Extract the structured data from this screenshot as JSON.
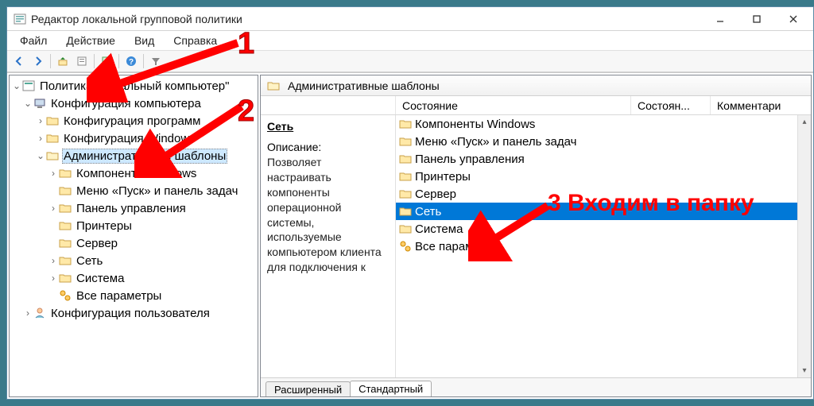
{
  "window": {
    "title": "Редактор локальной групповой политики"
  },
  "menu": {
    "file": "Файл",
    "action": "Действие",
    "view": "Вид",
    "help": "Справка"
  },
  "tree": {
    "root": "Политика \"Локальный компьютер\"",
    "comp_cfg": "Конфигурация компьютера",
    "sw_cfg": "Конфигурация программ",
    "win_cfg": "Конфигурация Windows",
    "admin_tpl": "Административные шаблоны",
    "comp_win": "Компоненты Windows",
    "start_menu": "Меню «Пуск» и панель задач",
    "ctrl_panel": "Панель управления",
    "printers": "Принтеры",
    "server": "Сервер",
    "network": "Сеть",
    "system": "Система",
    "all_params": "Все параметры",
    "user_cfg": "Конфигурация пользователя"
  },
  "detail": {
    "header": "Административные шаблоны",
    "section_title": "Сеть",
    "desc_label": "Описание:",
    "desc_text": "Позволяет настраивать компоненты операционной системы, используемые компьютером клиента для подключения к",
    "columns": {
      "state": "Состояние",
      "state2": "Состоян...",
      "comment": "Комментари"
    },
    "items": {
      "comp_win": "Компоненты Windows",
      "start_menu": "Меню «Пуск» и панель задач",
      "ctrl_panel": "Панель управления",
      "printers": "Принтеры",
      "server": "Сервер",
      "network": "Сеть",
      "system": "Система",
      "all_params": "Все параметры"
    },
    "tabs": {
      "extended": "Расширенный",
      "standard": "Стандартный"
    }
  },
  "annotations": {
    "n1": "1",
    "n2": "2",
    "n3": "3 Входим в папку"
  }
}
